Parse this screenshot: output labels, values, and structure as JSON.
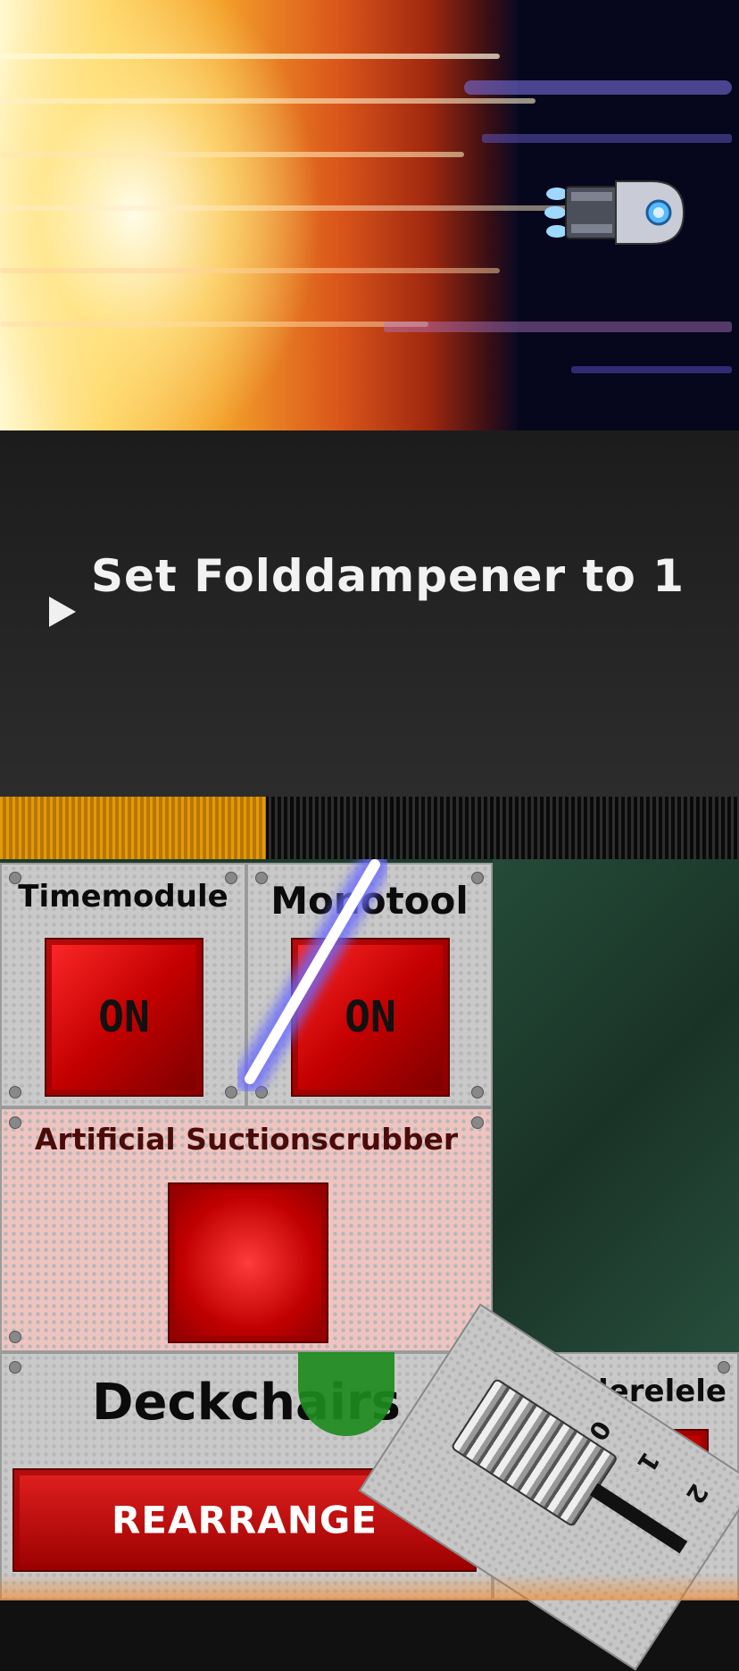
{
  "scene": {
    "description_icons": [
      "sun-icon",
      "spaceship-icon"
    ],
    "colors": {
      "sun": "#f3a02a",
      "space": "#06061c",
      "engine": "#5ab8ff"
    }
  },
  "instruction": {
    "text": "Set Folddampener to 1",
    "icon": "play-arrow-icon"
  },
  "timer": {
    "remaining_fraction": 0.36,
    "colors": {
      "fill": "#e39a07",
      "empty": "#1a1a1a"
    }
  },
  "controls": {
    "timemodule": {
      "label": "Timemodule",
      "button": "ON"
    },
    "monotool": {
      "label": "Monotool",
      "button": "ON"
    },
    "suctionscrubber": {
      "label": "Artificial Suctionscrubber"
    },
    "deckchairs": {
      "label": "Deckchairs",
      "button": "REARRANGE"
    },
    "partial_panel": {
      "label": "derelele"
    },
    "lever": {
      "marks": [
        "0",
        "1",
        "2"
      ],
      "selected": "0"
    }
  },
  "colors": {
    "button_red": "#c40000",
    "status_light": "#1d8a1d",
    "circuit": "#1d3b2c"
  }
}
